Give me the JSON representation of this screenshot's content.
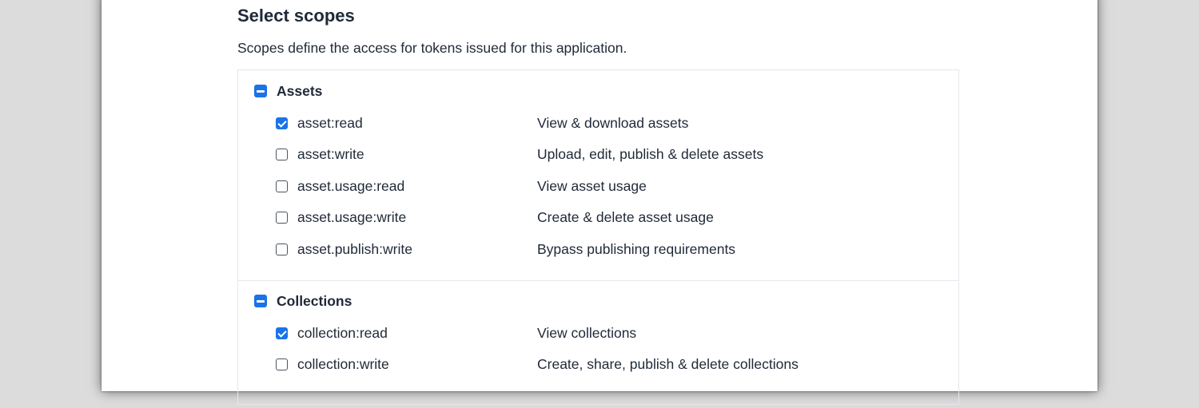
{
  "header": {
    "title": "Select scopes",
    "subtitle": "Scopes define the access for tokens issued for this application."
  },
  "groups": [
    {
      "label": "Assets",
      "state": "indeterminate",
      "scopes": [
        {
          "name": "asset:read",
          "description": "View & download assets",
          "checked": true
        },
        {
          "name": "asset:write",
          "description": "Upload, edit, publish & delete assets",
          "checked": false
        },
        {
          "name": "asset.usage:read",
          "description": "View asset usage",
          "checked": false
        },
        {
          "name": "asset.usage:write",
          "description": "Create & delete asset usage",
          "checked": false
        },
        {
          "name": "asset.publish:write",
          "description": "Bypass publishing requirements",
          "checked": false
        }
      ]
    },
    {
      "label": "Collections",
      "state": "indeterminate",
      "scopes": [
        {
          "name": "collection:read",
          "description": "View collections",
          "checked": true
        },
        {
          "name": "collection:write",
          "description": "Create, share, publish & delete collections",
          "checked": false
        }
      ]
    }
  ],
  "colors": {
    "accent": "#1a73e8",
    "text": "#1f2937",
    "border": "#e5e7eb",
    "backdrop": "#dcdcdc"
  }
}
